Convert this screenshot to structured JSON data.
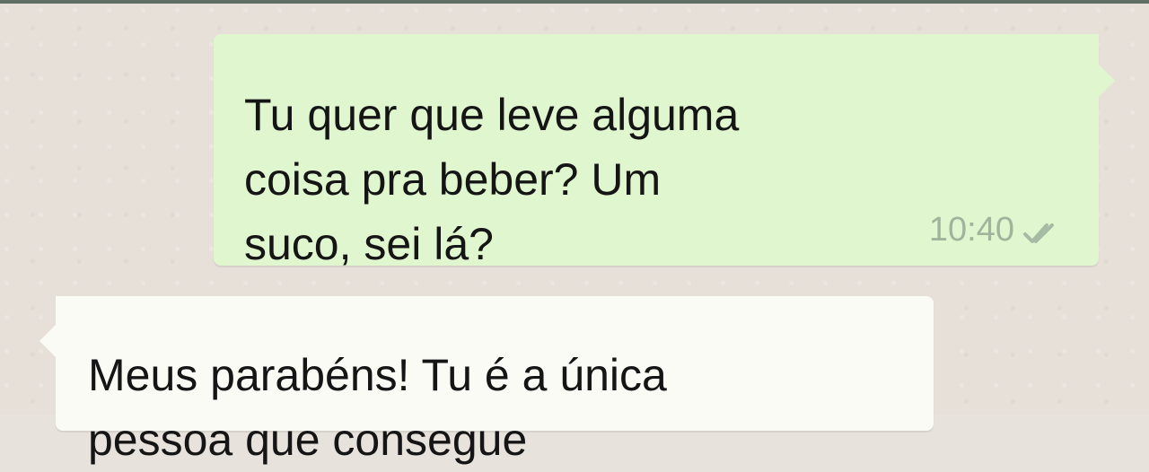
{
  "conversation": {
    "messages": [
      {
        "direction": "outgoing",
        "lines": [
          "Tu quer que leve alguma",
          "coisa pra beber? Um",
          "suco, sei lá?"
        ],
        "time": "10:40",
        "status_icon": "double-check-icon"
      },
      {
        "direction": "incoming",
        "lines": [
          "Meus parabéns! Tu é a única",
          "pessoa que consegue"
        ]
      }
    ]
  },
  "colors": {
    "background": "#e6e0d9",
    "outgoing_bubble": "#dff6cf",
    "incoming_bubble": "#fbfbf6",
    "text": "#151515",
    "meta": "#9fb59b",
    "top_strip": "#5f6f66"
  }
}
